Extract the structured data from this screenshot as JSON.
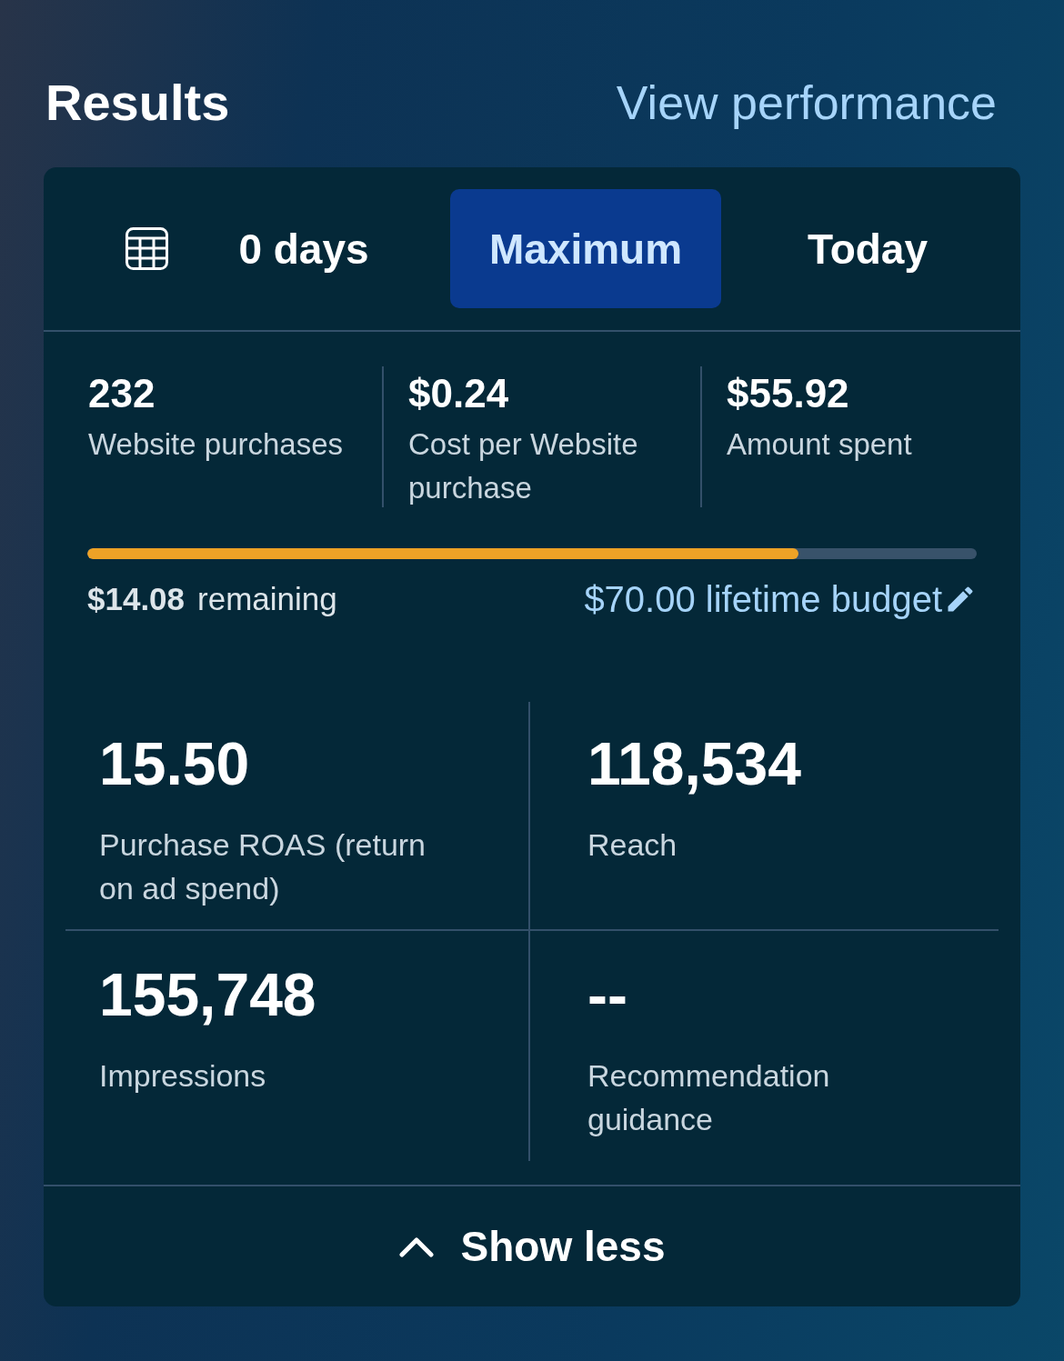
{
  "header": {
    "title": "Results",
    "link": "View performance"
  },
  "tabs": [
    {
      "label": "0 days",
      "selected": false
    },
    {
      "label": "Maximum",
      "selected": true
    },
    {
      "label": "Today",
      "selected": false
    }
  ],
  "summary": [
    {
      "value": "232",
      "label": "Website purchases"
    },
    {
      "value": "$0.24",
      "label": "Cost per Website purchase"
    },
    {
      "value": "$55.92",
      "label": "Amount spent"
    }
  ],
  "budget": {
    "level": 0.8,
    "remaining_amount": "$14.08",
    "remaining_label": "remaining",
    "budget_link": "$70.00 lifetime budget"
  },
  "metrics": [
    {
      "value": "15.50",
      "label": "Purchase ROAS (return on ad spend)"
    },
    {
      "value": "118,534",
      "label": "Reach"
    },
    {
      "value": "155,748",
      "label": "Impressions"
    },
    {
      "value": "--",
      "label": "Recommendation guidance"
    }
  ],
  "footer": {
    "toggle": "Show less"
  }
}
